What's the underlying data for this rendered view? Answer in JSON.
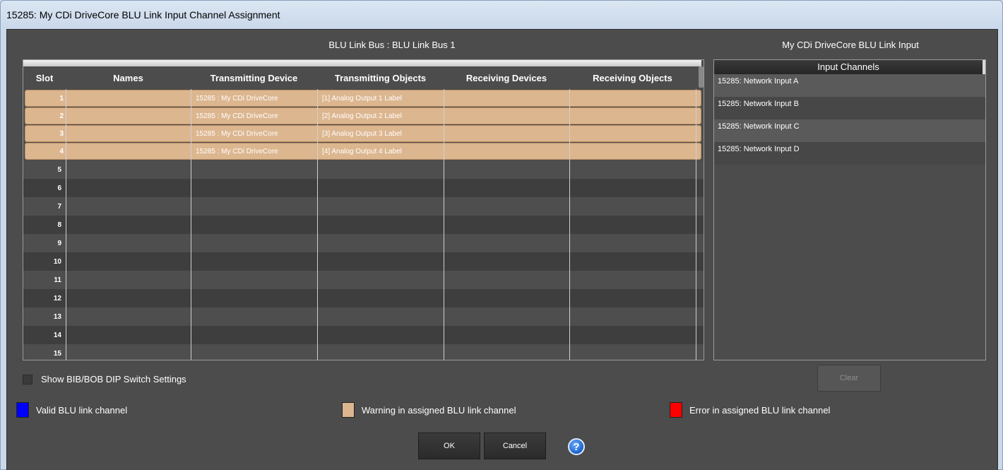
{
  "window": {
    "title": "15285: My CDi DriveCore BLU Link Input Channel Assignment"
  },
  "bus_title": "BLU Link Bus : BLU Link Bus 1",
  "right_title": "My CDi DriveCore  BLU Link Input",
  "grid": {
    "columns": [
      "Slot",
      "Names",
      "Transmitting Device",
      "Transmitting Objects",
      "Receiving Devices",
      "Receiving Objects"
    ],
    "rows": [
      {
        "slot": "1",
        "name": "",
        "tx_device": "15285 : My CDi DriveCore",
        "tx_object": "[1] Analog Output 1 Label",
        "rx_device": "",
        "rx_object": "",
        "assigned": true
      },
      {
        "slot": "2",
        "name": "",
        "tx_device": "15285 : My CDi DriveCore",
        "tx_object": "[2] Analog Output 2 Label",
        "rx_device": "",
        "rx_object": "",
        "assigned": true
      },
      {
        "slot": "3",
        "name": "",
        "tx_device": "15285 : My CDi DriveCore",
        "tx_object": "[3] Analog Output 3 Label",
        "rx_device": "",
        "rx_object": "",
        "assigned": true
      },
      {
        "slot": "4",
        "name": "",
        "tx_device": "15285 : My CDi DriveCore",
        "tx_object": "[4] Analog Output 4 Label",
        "rx_device": "",
        "rx_object": "",
        "assigned": true
      },
      {
        "slot": "5",
        "name": "",
        "tx_device": "",
        "tx_object": "",
        "rx_device": "",
        "rx_object": "",
        "assigned": false
      },
      {
        "slot": "6",
        "name": "",
        "tx_device": "",
        "tx_object": "",
        "rx_device": "",
        "rx_object": "",
        "assigned": false
      },
      {
        "slot": "7",
        "name": "",
        "tx_device": "",
        "tx_object": "",
        "rx_device": "",
        "rx_object": "",
        "assigned": false
      },
      {
        "slot": "8",
        "name": "",
        "tx_device": "",
        "tx_object": "",
        "rx_device": "",
        "rx_object": "",
        "assigned": false
      },
      {
        "slot": "9",
        "name": "",
        "tx_device": "",
        "tx_object": "",
        "rx_device": "",
        "rx_object": "",
        "assigned": false
      },
      {
        "slot": "10",
        "name": "",
        "tx_device": "",
        "tx_object": "",
        "rx_device": "",
        "rx_object": "",
        "assigned": false
      },
      {
        "slot": "11",
        "name": "",
        "tx_device": "",
        "tx_object": "",
        "rx_device": "",
        "rx_object": "",
        "assigned": false
      },
      {
        "slot": "12",
        "name": "",
        "tx_device": "",
        "tx_object": "",
        "rx_device": "",
        "rx_object": "",
        "assigned": false
      },
      {
        "slot": "13",
        "name": "",
        "tx_device": "",
        "tx_object": "",
        "rx_device": "",
        "rx_object": "",
        "assigned": false
      },
      {
        "slot": "14",
        "name": "",
        "tx_device": "",
        "tx_object": "",
        "rx_device": "",
        "rx_object": "",
        "assigned": false
      },
      {
        "slot": "15",
        "name": "",
        "tx_device": "",
        "tx_object": "",
        "rx_device": "",
        "rx_object": "",
        "assigned": false
      }
    ]
  },
  "input_channels": {
    "header": "Input Channels",
    "items": [
      "15285: Network Input A",
      "15285: Network Input B",
      "15285: Network Input C",
      "15285: Network Input D"
    ]
  },
  "clear_label": "Clear",
  "show_dip_label": "Show BIB/BOB DIP Switch Settings",
  "legend": {
    "valid": {
      "label": "Valid BLU link channel",
      "color": "#0000ff"
    },
    "warning": {
      "label": "Warning in assigned BLU link channel",
      "color": "#dcb68f"
    },
    "error": {
      "label": "Error in assigned BLU link channel",
      "color": "#ff0000"
    }
  },
  "ok_label": "OK",
  "cancel_label": "Cancel",
  "help_icon": "help-icon",
  "help_glyph": "?"
}
